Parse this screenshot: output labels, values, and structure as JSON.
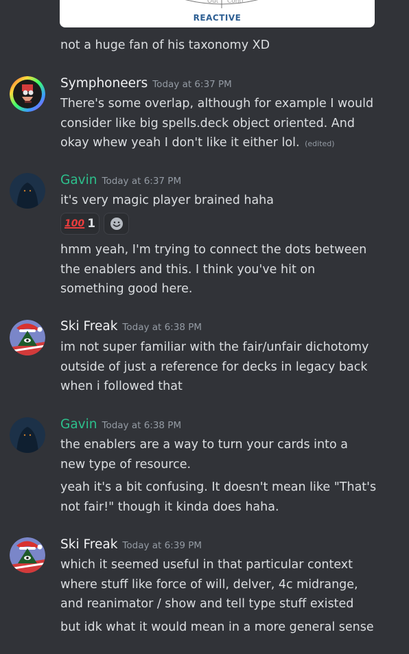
{
  "embed": {
    "label": "REACTIVE"
  },
  "continuation_first": "not a huge fan of his taxonomy XD",
  "messages": [
    {
      "username": "Symphoneers",
      "username_color": "#f2f3f5",
      "timestamp": "Today at 6:37 PM",
      "lines": [
        "There's some overlap, although for example I would",
        "consider like big spells.deck object oriented. And",
        "okay whew yeah I don't like it either lol."
      ],
      "edited_label": "(edited)"
    },
    {
      "username": "Gavin",
      "username_color": "#2dc08c",
      "timestamp": "Today at 6:37 PM",
      "lines": [
        "it's very magic player brained haha"
      ],
      "reactions": [
        {
          "emoji": "100-emoji",
          "emoji_text": "100",
          "count": "1"
        },
        {
          "emoji": "add-reaction-smiley-icon"
        }
      ],
      "followup_lines": [
        "hmm yeah, I'm trying to connect the dots between",
        "the enablers and this. I think you've hit on",
        "something good here."
      ]
    },
    {
      "username": "Ski Freak",
      "username_color": "#f2f3f5",
      "timestamp": "Today at 6:38 PM",
      "lines": [
        "im not super familiar with the fair/unfair dichotomy",
        "outside of just a reference for decks in legacy back",
        "when i followed that"
      ]
    },
    {
      "username": "Gavin",
      "username_color": "#2dc08c",
      "timestamp": "Today at 6:38 PM",
      "lines": [
        "the enablers are a way to turn your cards into a",
        "new type of resource."
      ],
      "followup_lines": [
        "yeah it's a bit confusing. It doesn't mean like \"That's",
        "not fair!\" though it kinda does haha."
      ]
    },
    {
      "username": "Ski Freak",
      "username_color": "#f2f3f5",
      "timestamp": "Today at 6:39 PM",
      "lines": [
        "which it seemed useful in that particular context",
        "where stuff like force of will, delver, 4c midrange,",
        "and reanimator / show and tell type stuff existed"
      ],
      "followup_lines": [
        "but idk what it would mean in a more general sense"
      ]
    }
  ]
}
